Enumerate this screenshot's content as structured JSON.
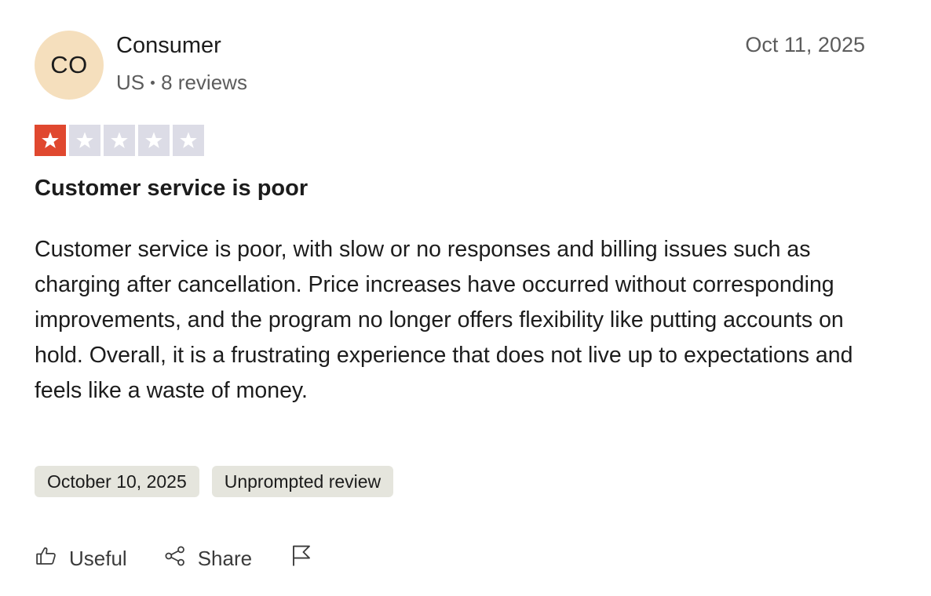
{
  "reviewer": {
    "initials": "CO",
    "name": "Consumer",
    "country": "US",
    "reviews_count": "8 reviews"
  },
  "review": {
    "date": "Oct 11, 2025",
    "rating": 1,
    "max_rating": 5,
    "title": "Customer service is poor",
    "body": "Customer service is poor, with slow or no responses and billing issues such as charging after cancellation. Price increases have occurred without corresponding improvements, and the program no longer offers flexibility like putting accounts on hold. Overall, it is a frustrating experience that does not live up to expectations and feels like a waste of money.",
    "experience_date": "October 10, 2025",
    "tag": "Unprompted review"
  },
  "actions": {
    "useful_label": "Useful",
    "share_label": "Share"
  },
  "colors": {
    "star_filled": "#e0482f",
    "star_empty": "#dcdce6",
    "avatar_bg": "#f5dfbd",
    "chip_bg": "#e5e5dd"
  },
  "icons": {
    "useful": "thumbs-up-icon",
    "share": "share-icon",
    "report": "flag-icon",
    "star": "star-icon"
  }
}
